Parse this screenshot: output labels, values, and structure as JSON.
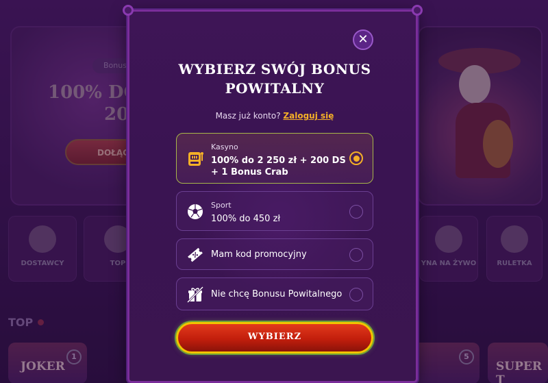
{
  "background": {
    "badge": "Bonus",
    "headline_line1": "100% DO",
    "headline_line2": "20",
    "join_button": "DOŁĄC",
    "categories": [
      "DOSTAWCY",
      "TOP",
      "YNA NA ŻYWO",
      "RULETKA"
    ],
    "section_title": "TOP",
    "games": [
      {
        "title": "JOKER",
        "rank": "1"
      },
      {
        "title": "",
        "rank": "5"
      },
      {
        "title": "SUPER T",
        "rank": ""
      }
    ]
  },
  "modal": {
    "close_label": "✕",
    "title": "WYBIERZ SWÓJ BONUS POWITALNY",
    "login_prompt": "Masz już konto?",
    "login_link": "Zaloguj się",
    "options": [
      {
        "label": "Kasyno",
        "value": "100% do 2 250 zł + 200 DS + 1 Bonus Crab",
        "icon": "slot-machine-icon",
        "selected": true
      },
      {
        "label": "Sport",
        "value": "100% do 450 zł",
        "icon": "soccer-ball-icon",
        "selected": false
      },
      {
        "label": "",
        "value": "Mam kod promocyjny",
        "icon": "promo-ticket-icon",
        "selected": false
      },
      {
        "label": "",
        "value": "Nie chcę Bonusu Powitalnego",
        "icon": "gift-crossed-icon",
        "selected": false
      }
    ],
    "choose_button": "WYBIERZ"
  },
  "colors": {
    "accent_orange": "#f5b027",
    "modal_bg": "#3c1554",
    "modal_border": "#7a2d9a",
    "button_red": "#d02a14",
    "selected_border": "#a8b84a"
  }
}
